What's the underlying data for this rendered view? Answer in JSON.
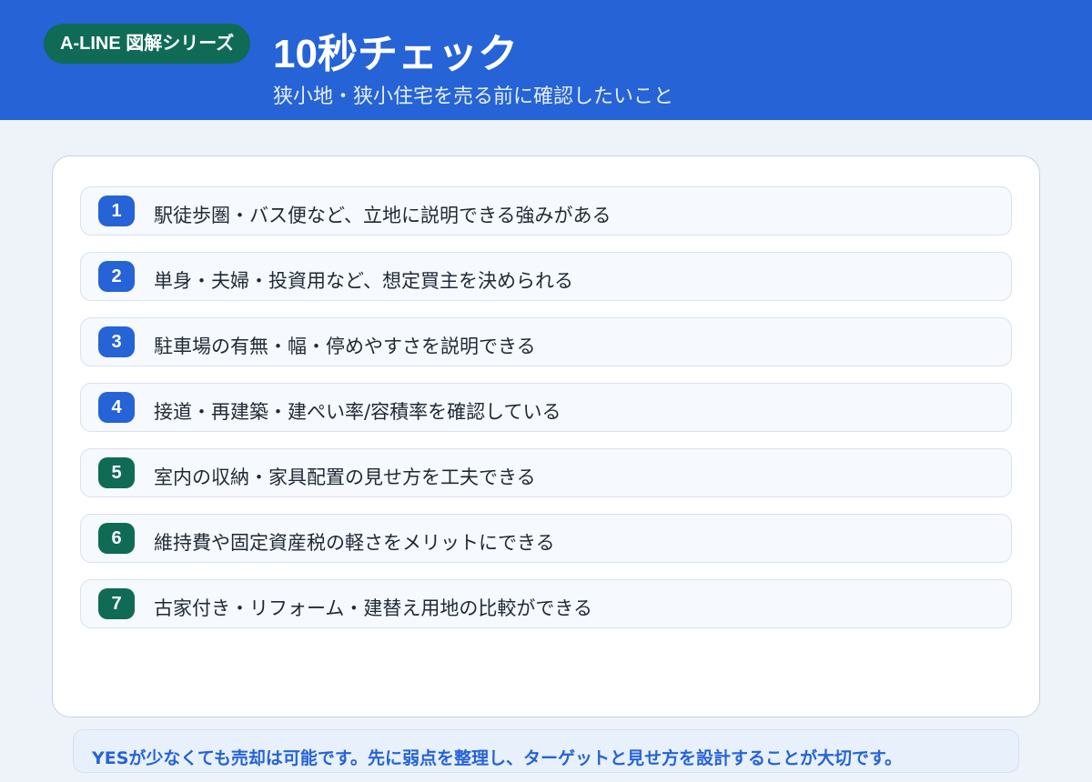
{
  "header": {
    "badge": "A-LINE 図解シリーズ",
    "title": "10秒チェック",
    "subtitle": "狭小地・狭小住宅を売る前に確認したいこと",
    "background_color": "#2563d6",
    "badge_color": "#0f6b55"
  },
  "checklist": {
    "items": [
      {
        "number": "1",
        "text": "駅徒歩圏・バス便など、立地に説明できる強みがある",
        "color": "#2563d6"
      },
      {
        "number": "2",
        "text": "単身・夫婦・投資用など、想定買主を決められる",
        "color": "#2563d6"
      },
      {
        "number": "3",
        "text": "駐車場の有無・幅・停めやすさを説明できる",
        "color": "#2563d6"
      },
      {
        "number": "4",
        "text": "接道・再建築・建ぺい率/容積率を確認している",
        "color": "#2563d6"
      },
      {
        "number": "5",
        "text": "室内の収納・家具配置の見せ方を工夫できる",
        "color": "#0f6b55"
      },
      {
        "number": "6",
        "text": "維持費や固定資産税の軽さをメリットにできる",
        "color": "#0f6b55"
      },
      {
        "number": "7",
        "text": "古家付き・リフォーム・建替え用地の比較ができる",
        "color": "#0f6b55"
      }
    ]
  },
  "footer": {
    "text": "YESが少なくても売却は可能です。先に弱点を整理し、ターゲットと見せ方を設計することが大切です。",
    "text_color": "#2563d6"
  }
}
